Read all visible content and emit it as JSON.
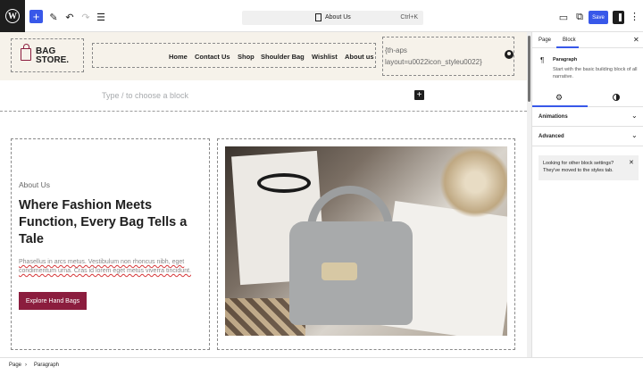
{
  "toolbar": {
    "document_title": "About Us",
    "shortcut": "Ctrl+K",
    "save_label": "Save",
    "icons": [
      "wordpress-logo",
      "add-block",
      "pencil-tools",
      "undo",
      "redo",
      "document-overview",
      "view-desktop",
      "view-external",
      "settings-panel",
      "options-menu"
    ]
  },
  "site_header": {
    "logo_line1": "BAG",
    "logo_line2": "STORE.",
    "nav": [
      "Home",
      "Contact Us",
      "Shop",
      "Shoulder Bag",
      "Wishlist",
      "About us"
    ],
    "code_line1": "{th-aps",
    "code_line2": "layout=u0022icon_styleu0022}"
  },
  "placeholder": "Type / to choose a block",
  "content": {
    "eyebrow": "About Us",
    "heading": "Where Fashion Meets Function, Every Bag Tells a Tale",
    "body": "Phasellus in arcs metus. Vestibulum non rhoncus nibh, eget condimentum urna. Cras id lorem eget metus viverra tincidunt.",
    "button": "Explore Hand Bags"
  },
  "sidebar": {
    "tab_page": "Page",
    "tab_block": "Block",
    "block_title": "Paragraph",
    "block_desc": "Start with the basic building block of all narrative.",
    "panel_animations": "Animations",
    "panel_advanced": "Advanced",
    "notice": "Looking for other block settings? They've moved to the styles tab."
  },
  "breadcrumb": [
    "Page",
    "Paragraph"
  ],
  "colors": {
    "accent": "#3858e9",
    "brand": "#8b1d3e",
    "header_bg": "#f6f2ea"
  }
}
